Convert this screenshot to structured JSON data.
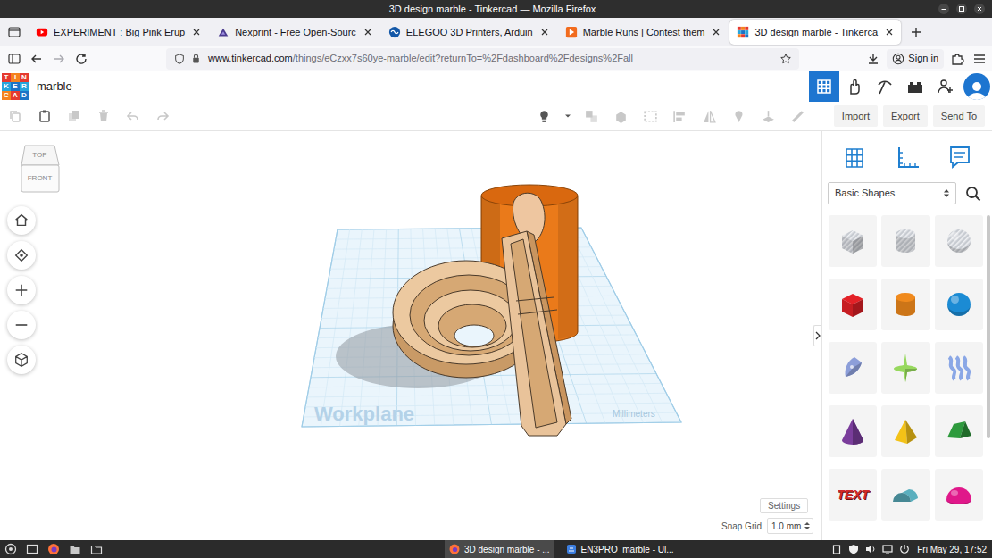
{
  "window": {
    "title": "3D design marble - Tinkercad — Mozilla Firefox"
  },
  "tabs": [
    {
      "label": "EXPERIMENT : Big Pink Erup",
      "selected": false,
      "kind": "youtube"
    },
    {
      "label": "Nexprint - Free Open-Sourc",
      "selected": false,
      "kind": "nexprint"
    },
    {
      "label": "ELEGOO 3D Printers, Arduin",
      "selected": false,
      "kind": "elegoo"
    },
    {
      "label": "Marble Runs | Contest them",
      "selected": false,
      "kind": "instructables"
    },
    {
      "label": "3D design marble - Tinkerca",
      "selected": true,
      "kind": "tinkercad"
    }
  ],
  "address": {
    "host": "www.tinkercad.com",
    "path": "/things/eCzxx7s60ye-marble/edit?returnTo=%2Fdashboard%2Fdesigns%2Fall"
  },
  "account": {
    "label": "Sign in"
  },
  "app": {
    "logo": [
      {
        "letter": "T",
        "color": "#e5392f"
      },
      {
        "letter": "I",
        "color": "#f5821f"
      },
      {
        "letter": "N",
        "color": "#e5392f"
      },
      {
        "letter": "K",
        "color": "#27a5dc"
      },
      {
        "letter": "E",
        "color": "#1c74c6"
      },
      {
        "letter": "R",
        "color": "#27a5dc"
      },
      {
        "letter": "C",
        "color": "#f5821f"
      },
      {
        "letter": "A",
        "color": "#e5392f"
      },
      {
        "letter": "D",
        "color": "#1c74c6"
      }
    ],
    "design_name": "marble",
    "views": [
      {
        "kind": "3d",
        "selected": true
      },
      {
        "kind": "circuits",
        "selected": false
      },
      {
        "kind": "codeblocks",
        "selected": false
      },
      {
        "kind": "bricks",
        "selected": false
      }
    ]
  },
  "toolbar": {
    "edit": [
      {
        "kind": "copy",
        "disabled": true
      },
      {
        "kind": "paste",
        "disabled": false
      },
      {
        "kind": "duplicate",
        "disabled": true
      },
      {
        "kind": "delete",
        "disabled": true
      },
      {
        "kind": "undo",
        "disabled": true
      },
      {
        "kind": "redo",
        "disabled": true
      }
    ],
    "tools": [
      {
        "kind": "light",
        "disabled": false
      },
      {
        "kind": "light-menu",
        "disabled": false
      },
      {
        "kind": "group",
        "disabled": true
      },
      {
        "kind": "solid",
        "disabled": true
      },
      {
        "kind": "hole",
        "disabled": true
      },
      {
        "kind": "align",
        "disabled": true
      },
      {
        "kind": "mirror",
        "disabled": true
      },
      {
        "kind": "cruise",
        "disabled": true
      },
      {
        "kind": "workplane-tool",
        "disabled": true
      },
      {
        "kind": "ruler-tool",
        "disabled": true
      }
    ],
    "actions": [
      "Import",
      "Export",
      "Send To"
    ]
  },
  "view_cube": {
    "top": "TOP",
    "front": "FRONT"
  },
  "workplane": {
    "label": "Workplane",
    "units": "Millimeters"
  },
  "settings": {
    "label": "Settings"
  },
  "snap_grid": {
    "label": "Snap Grid",
    "value": "1.0 mm"
  },
  "shapes_panel": {
    "category": "Basic Shapes",
    "shapes": [
      {
        "kind": "box",
        "hole": true,
        "color": "#c3c7ce"
      },
      {
        "kind": "cylinder",
        "hole": true,
        "color": "#c3c7ce"
      },
      {
        "kind": "sphere",
        "hole": true,
        "color": "#c3c7ce"
      },
      {
        "kind": "box",
        "hole": false,
        "color": "#e32127"
      },
      {
        "kind": "cylinder",
        "hole": false,
        "color": "#f08a1d"
      },
      {
        "kind": "sphere",
        "hole": false,
        "color": "#1b8bd4"
      },
      {
        "kind": "scribble",
        "hole": false,
        "color": "#8c9ed9"
      },
      {
        "kind": "spinner",
        "hole": false,
        "color": "#97d85e"
      },
      {
        "kind": "squiggle",
        "hole": false,
        "color": "#8aa7e6"
      },
      {
        "kind": "cone",
        "hole": false,
        "color": "#7a3d9b"
      },
      {
        "kind": "pyramid",
        "hole": false,
        "color": "#f3c217"
      },
      {
        "kind": "roof",
        "hole": false,
        "color": "#2e9a3d"
      },
      {
        "kind": "text",
        "hole": false,
        "color": "#d22b2b",
        "label": "TEXT"
      },
      {
        "kind": "half-cylinder",
        "hole": false,
        "color": "#65c3d4"
      },
      {
        "kind": "half-sphere",
        "hole": false,
        "color": "#e0188a"
      }
    ]
  },
  "taskbar": {
    "windows": [
      {
        "label": "3D design marble - ...",
        "selected": true,
        "kind": "firefox"
      },
      {
        "label": "EN3PRO_marble - Ul...",
        "selected": false,
        "kind": "slicer"
      }
    ],
    "clock": "Fri May 29, 17:52"
  }
}
